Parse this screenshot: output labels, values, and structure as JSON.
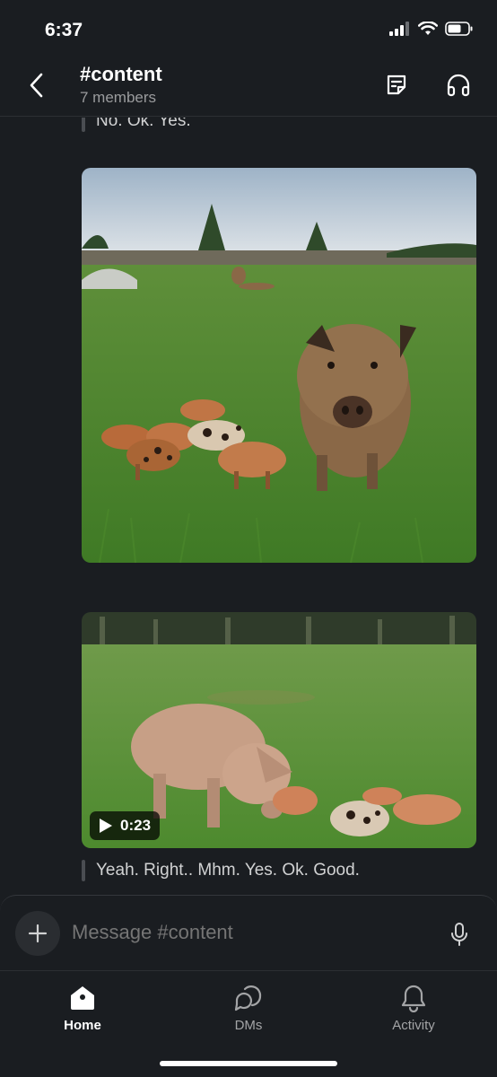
{
  "status_bar": {
    "time": "6:37"
  },
  "header": {
    "channel_name": "#content",
    "member_count": "7 members",
    "icons": [
      "back-chevron-icon",
      "canvas-note-icon",
      "headphones-huddle-icon"
    ]
  },
  "messages": [
    {
      "type": "quote",
      "text": "No. Ok. Yes."
    },
    {
      "type": "image",
      "description_icon": "photo"
    },
    {
      "type": "video",
      "duration": "0:23",
      "icon": "play-icon"
    },
    {
      "type": "quote",
      "text": "Yeah. Right.. Mhm. Yes. Ok. Good."
    }
  ],
  "composer": {
    "placeholder": "Message #content",
    "icons": [
      "plus-icon",
      "microphone-icon"
    ]
  },
  "tabs": [
    {
      "label": "Home",
      "icon": "home-icon",
      "active": true
    },
    {
      "label": "DMs",
      "icon": "dms-icon",
      "active": false
    },
    {
      "label": "Activity",
      "icon": "bell-icon",
      "active": false
    }
  ],
  "colors": {
    "background": "#1a1d21",
    "text": "#d1d2d3",
    "muted": "#9a9b9d",
    "active": "#ffffff"
  }
}
